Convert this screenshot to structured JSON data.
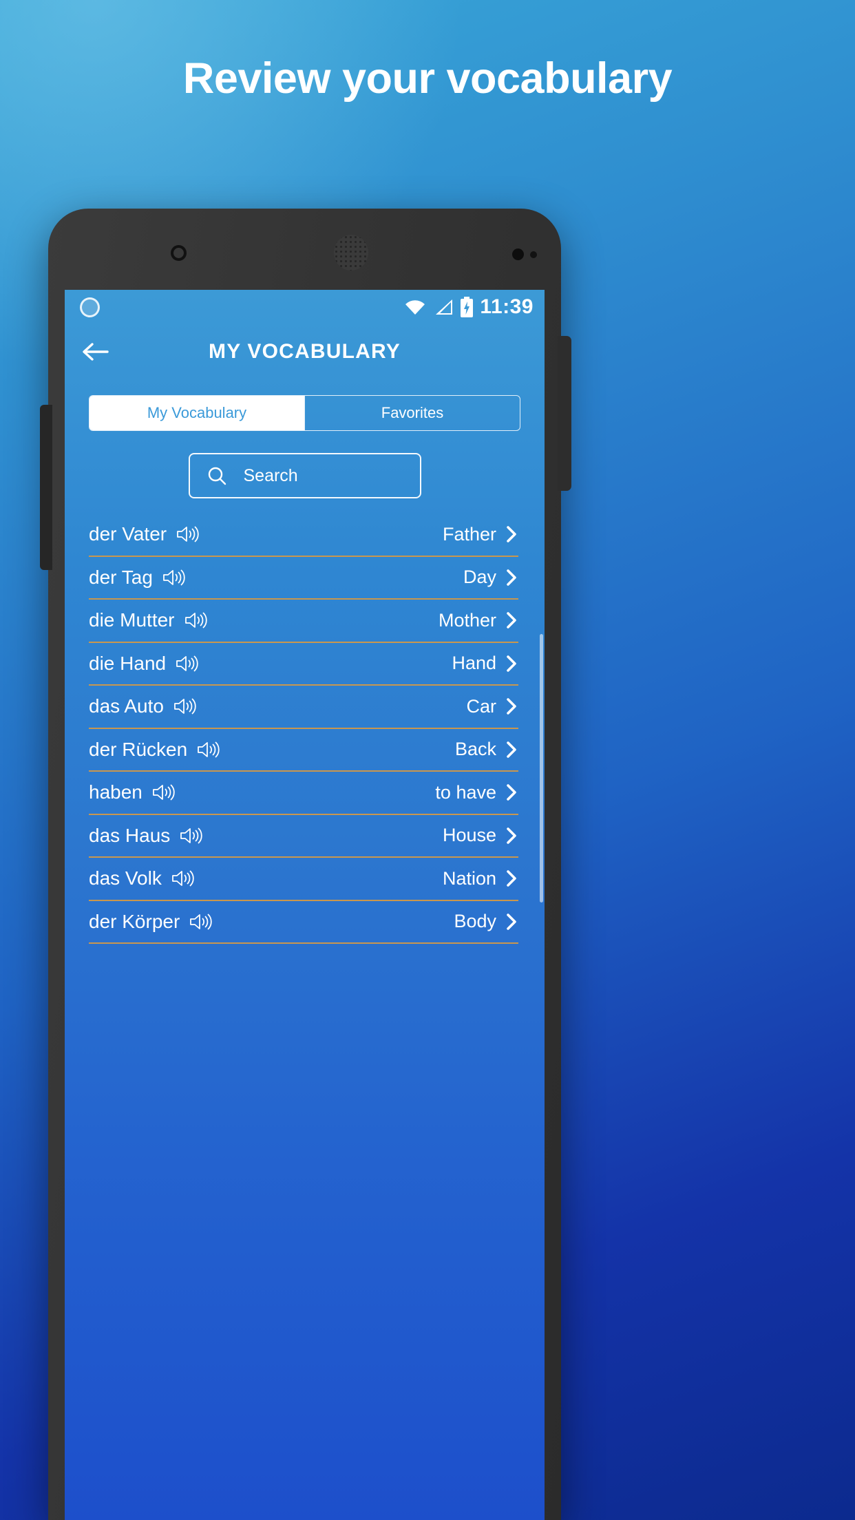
{
  "promo": {
    "headline": "Review your vocabulary"
  },
  "phone": {
    "status_bar": {
      "time": "11:39",
      "icons": [
        "wifi-icon",
        "signal-icon",
        "battery-charging-icon"
      ],
      "left_indicator": "sync-circle-icon"
    },
    "app_bar": {
      "back_label": "back-arrow-icon",
      "title": "MY VOCABULARY"
    },
    "tabs": [
      {
        "label": "My Vocabulary",
        "active": true
      },
      {
        "label": "Favorites",
        "active": false
      }
    ],
    "search": {
      "placeholder": "Search",
      "value": "",
      "icon": "search-icon"
    },
    "list": {
      "speaker_icon": "speaker-icon",
      "chevron_icon": "chevron-right-icon",
      "items": [
        {
          "term": "der Vater",
          "translation": "Father"
        },
        {
          "term": "der Tag",
          "translation": "Day"
        },
        {
          "term": "die Mutter",
          "translation": "Mother"
        },
        {
          "term": "die Hand",
          "translation": "Hand"
        },
        {
          "term": "das Auto",
          "translation": "Car"
        },
        {
          "term": "der Rücken",
          "translation": "Back"
        },
        {
          "term": "haben",
          "translation": "to have"
        },
        {
          "term": "das Haus",
          "translation": "House"
        },
        {
          "term": "das Volk",
          "translation": "Nation"
        },
        {
          "term": "der Körper",
          "translation": "Body"
        }
      ]
    }
  },
  "colors": {
    "accent_blue": "#3b9ad9",
    "divider": "#c9974e",
    "text_light": "#ffffff",
    "background_top": "#3aa8d8",
    "background_bottom": "#0c2a8e"
  }
}
